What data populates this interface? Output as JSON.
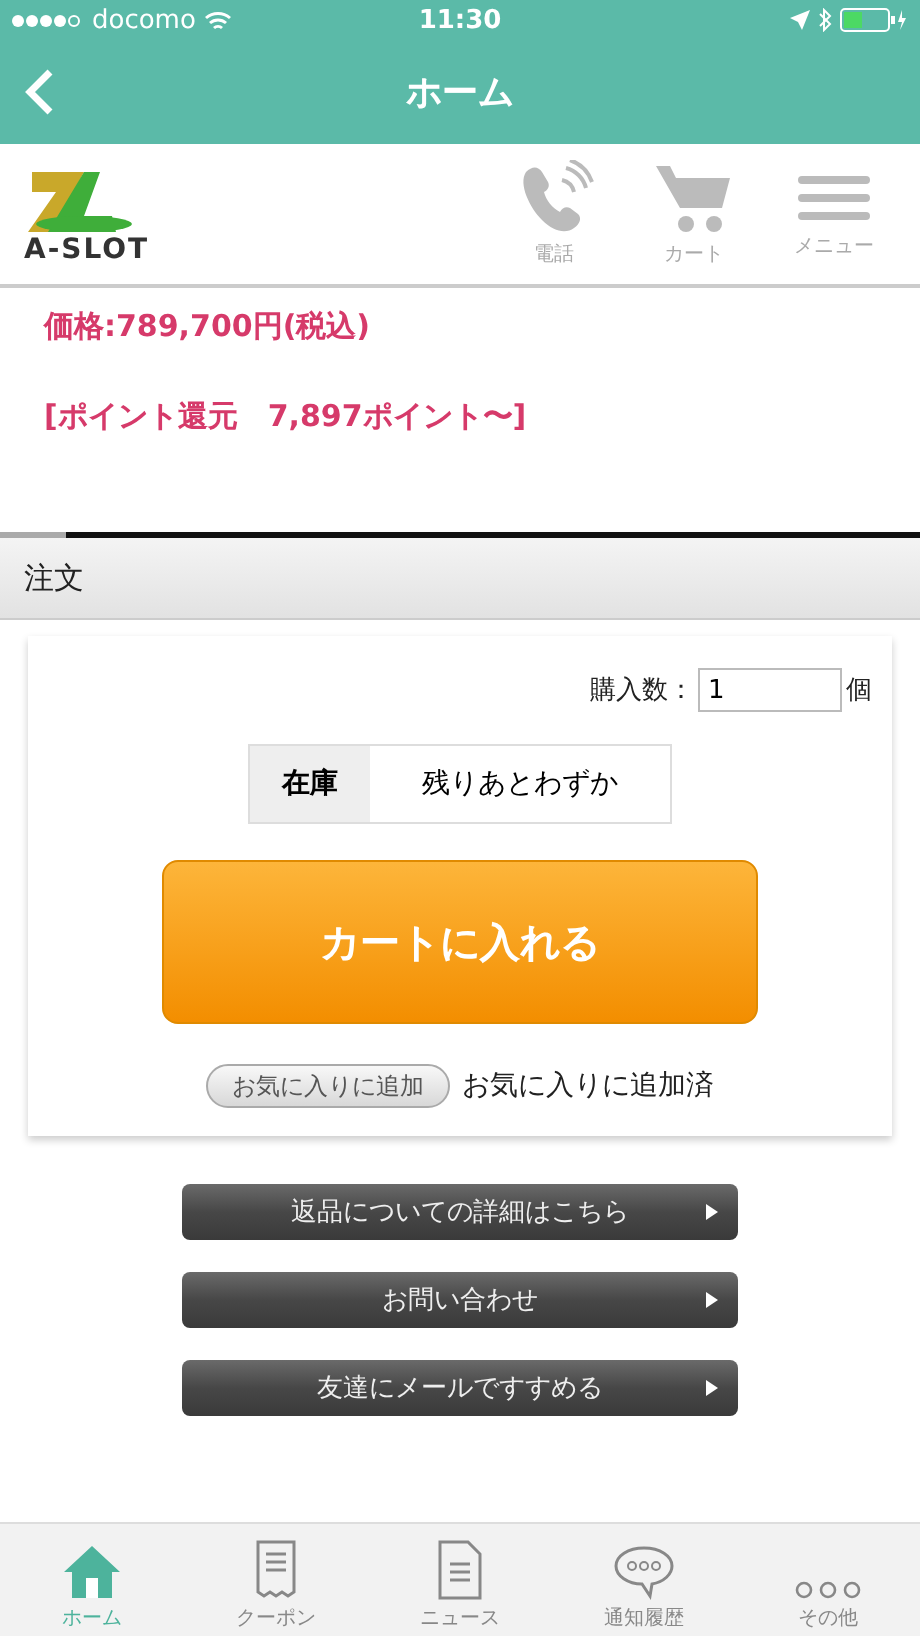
{
  "status_bar": {
    "carrier": "docomo",
    "time": "11:30"
  },
  "nav": {
    "title": "ホーム"
  },
  "header": {
    "logo_text": "A-SLOT",
    "actions": [
      {
        "label": "電話",
        "kind": "phone"
      },
      {
        "label": "カート",
        "kind": "cart"
      },
      {
        "label": "メニュー",
        "kind": "menu"
      }
    ]
  },
  "price": "価格:789,700円(税込)",
  "points": "[ポイント還元　7,897ポイント〜]",
  "order": {
    "title": "注文",
    "quantity_label": "購入数：",
    "quantity_value": "1",
    "unit": "個",
    "stock_label": "在庫",
    "stock_value": "残りあとわずか",
    "cart_button": "カートに入れる",
    "favorite_button": "お気に入りに追加",
    "favorite_status": "お気に入りに追加済"
  },
  "links": [
    "返品についての詳細はこちら",
    "お問い合わせ",
    "友達にメールですすめる"
  ],
  "tab_bar": [
    {
      "label": "ホーム",
      "kind": "home",
      "selected": true
    },
    {
      "label": "クーポン",
      "kind": "coupon",
      "selected": false
    },
    {
      "label": "ニュース",
      "kind": "news",
      "selected": false
    },
    {
      "label": "通知履歴",
      "kind": "chat",
      "selected": false
    },
    {
      "label": "その他",
      "kind": "more",
      "selected": false
    }
  ]
}
